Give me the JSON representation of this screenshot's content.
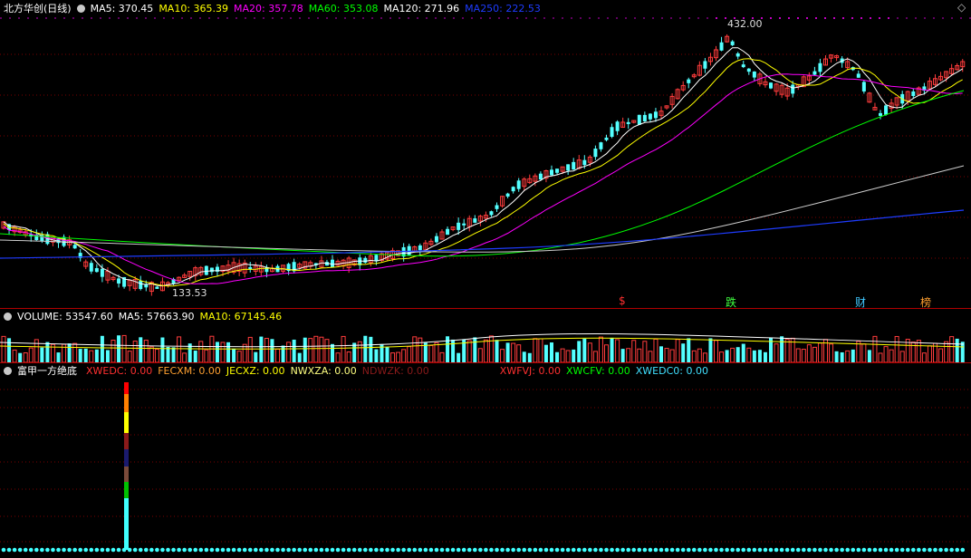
{
  "main": {
    "title": "北方华创(日线)",
    "ma": [
      {
        "label": "MA5: 370.45",
        "color": "#ffffff"
      },
      {
        "label": "MA10: 365.39",
        "color": "#ffff00"
      },
      {
        "label": "MA20: 357.78",
        "color": "#ff00ff"
      },
      {
        "label": "MA60: 353.08",
        "color": "#00ff00"
      },
      {
        "label": "MA120: 271.96",
        "color": "#ffffff"
      },
      {
        "label": "MA250: 222.53",
        "color": "#1e3cff"
      }
    ],
    "high_label": "432.00",
    "low_label": "133.53",
    "markers": [
      {
        "text": "$",
        "color": "#ff3030"
      },
      {
        "text": "跌",
        "color": "#40ff40"
      },
      {
        "text": "财",
        "color": "#40c8ff"
      },
      {
        "text": "榜",
        "color": "#ffa030"
      }
    ]
  },
  "volume": {
    "title": "VOLUME: 53547.60",
    "ma5": "MA5: 57663.90",
    "ma10": "MA10: 67145.46",
    "colors": {
      "title": "#ffffff",
      "ma5": "#ffffff",
      "ma10": "#ffff00"
    }
  },
  "indicator": {
    "title": "富甲一方绝底",
    "lines": [
      {
        "label": "XWEDC: 0.00",
        "color": "#ff3030"
      },
      {
        "label": "FECXM: 0.00",
        "color": "#ffa030"
      },
      {
        "label": "JECXZ: 0.00",
        "color": "#ffff00"
      },
      {
        "label": "NWXZA: 0.00",
        "color": "#ffff80"
      },
      {
        "label": "NDWZK: 0.00",
        "color": "#8b1a1a"
      },
      {
        "label": "",
        "color": "#000000"
      },
      {
        "label": "XWFVJ: 0.00",
        "color": "#ff3030"
      },
      {
        "label": "XWCFV: 0.00",
        "color": "#00ff00"
      },
      {
        "label": "XWEDC0: 0.00",
        "color": "#40e0ff"
      }
    ]
  },
  "colors": {
    "up": "#ff3c3c",
    "down": "#54ffff",
    "grid": "#7a0000",
    "separator": "#b00000",
    "dots": "#c000c0"
  },
  "icons": {
    "collapse": "circle-icon",
    "corner": "diamond-icon"
  }
}
